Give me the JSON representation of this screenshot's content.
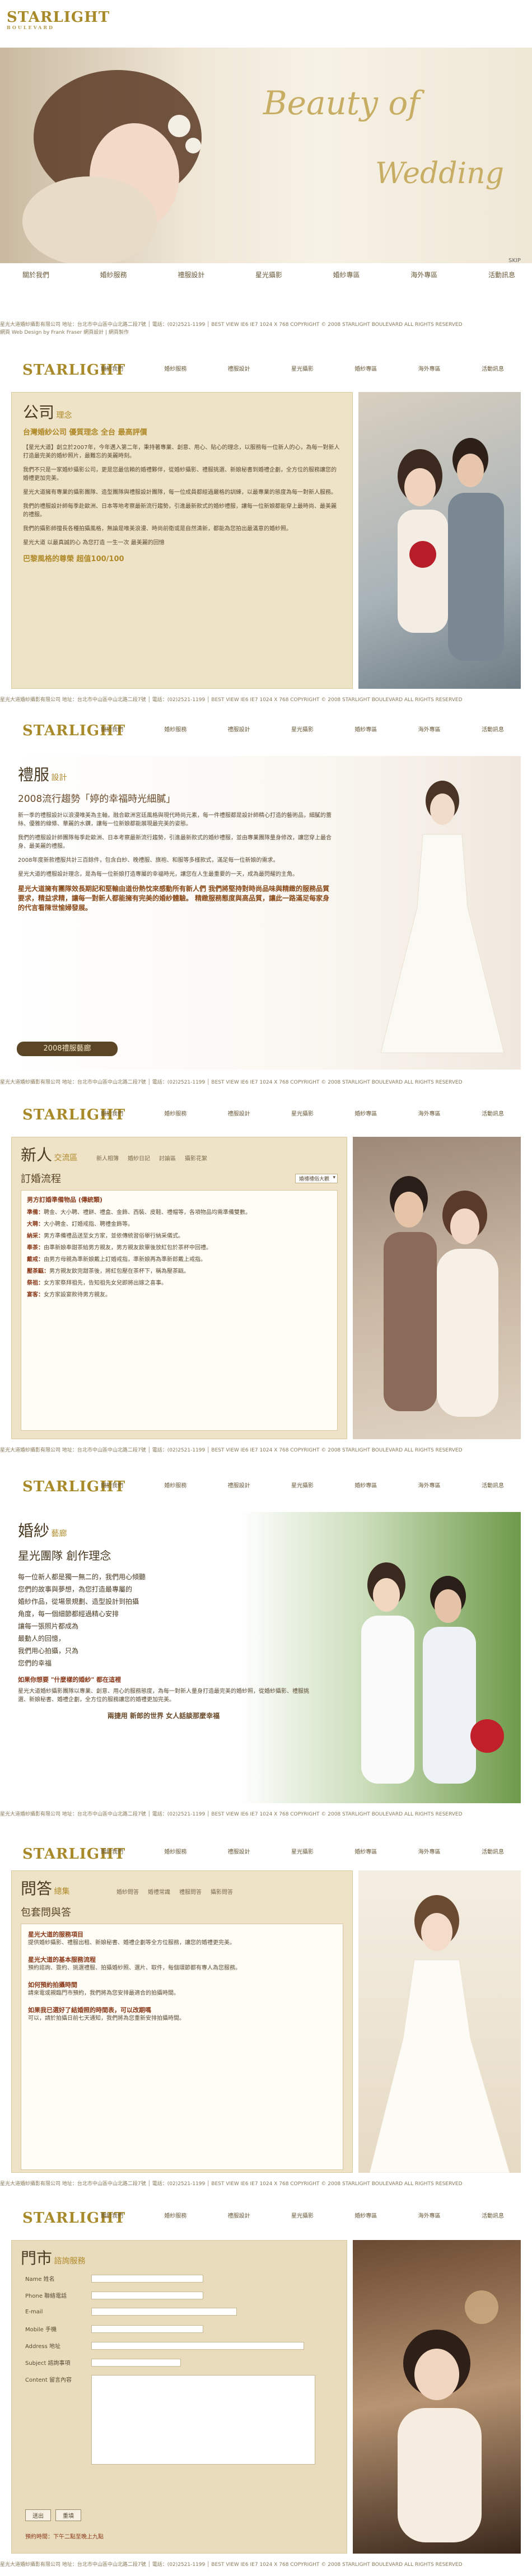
{
  "brand": {
    "logo": "STARLIGHT",
    "logo_sub": "BOULEVARD"
  },
  "hero": {
    "script_title": "Beauty of",
    "script_title2": "Wedding",
    "skip": "SKIP"
  },
  "nav": [
    "關於我們",
    "婚紗服務",
    "禮服設計",
    "星光攝影",
    "婚紗專區",
    "海外專區",
    "活動訊息"
  ],
  "footer": {
    "line1": "星光大道婚紗攝影有限公司 地址：台北市中山區中山北路二段7號 │ 電話：(02)2521-1199 │ BEST VIEW IE6 IE7 1024 X 768 COPYRIGHT © 2008 STARLIGHT BOULEVARD ALL RIGHTS RESERVED",
    "line2": "網頁 Web Design by Frank Fraser 網頁設計 | 網頁製作"
  },
  "company": {
    "title": "公司",
    "title_en": "理念",
    "headline": "台灣婚紗公司 優質理念 全台 最高評價",
    "paras": [
      "【星光大道】創立於2007年，今年邁入第二年，秉持著專業、創意、用心、貼心的理念，以服務每一位新人的心，為每一對新人打造最完美的婚紗照片，最難忘的美麗時刻。",
      "我們不只是一家婚紗攝影公司，更是您最信賴的婚禮夥伴，從婚紗攝影、禮服挑選、新娘秘書到婚禮企劃，全方位的服務讓您的婚禮更加完美。",
      "星光大道擁有專業的攝影團隊、造型團隊與禮服設計團隊，每一位成員都經過嚴格的訓練，以最專業的態度為每一對新人服務。",
      "我們的禮服設計師每季赴歐洲、日本等地考察最新流行趨勢，引進最新款式的婚紗禮服，讓每一位新娘都能穿上最時尚、最美麗的禮服。",
      "我們的攝影師擅長各種拍攝風格，無論是唯美浪漫、時尚前衛或是自然清新，都能為您拍出最滿意的婚紗照。",
      "星光大道 以最真誠的心 為您打造 一生一次 最美麗的回憶"
    ],
    "tagline": "巴黎風格的尊榮 超值100/100"
  },
  "gown": {
    "title": "禮服",
    "title_en": "設計",
    "headline": "2008流行趨勢「婷的幸福時光細膩」",
    "paras": [
      "新一季的禮服設計以浪漫唯美為主軸，融合歐洲宮廷風格與現代時尚元素，每一件禮服都是設計師精心打造的藝術品，細膩的蕾絲、優雅的線條、華麗的水鑽，讓每一位新娘都能展現最完美的姿態。",
      "我們的禮服設計師團隊每季赴歐洲、日本考察最新流行趨勢，引進最新款式的婚紗禮服，並由專業團隊量身修改，讓您穿上最合身、最美麗的禮服。",
      "2008年度新款禮服共計三百餘件，包含白紗、晚禮服、旗袍、和服等多樣款式，滿足每一位新娘的需求。",
      "星光大道的禮服設計理念，是為每一位新娘打造專屬的幸福時光，讓您在人生最重要的一天，成為最閃耀的主角。"
    ],
    "highlight": "星光大道擁有團隊效長期記和堅輸由道份熱忱來感動所有新人們 我們將堅持對時尚品味與精緻的服務品質要求，精益求精，讓每一對新人都能擁有完美的婚紗體驗。 精緻服務態度與高品質，讓此一路滿足每家身的代言看陳世愉婦發展。",
    "button": "2008禮服藝廊"
  },
  "couple": {
    "title": "新人",
    "title_en": "交流區",
    "tabs": [
      "新人相簿",
      "婚紗日記",
      "討論區",
      "攝影花絮"
    ],
    "panel_title": "訂婚流程",
    "select": "婚禮禮俗大觀",
    "sub": "男方訂婚準備物品 (傳統類)",
    "steps": [
      {
        "label": "準備：",
        "text": "聘金、大小聘、禮餅、禮盒、金飾、西裝、皮鞋、禮帽等，各項物品均需準備雙數。"
      },
      {
        "label": "大聘：",
        "text": "大小聘金、訂婚戒指、聘禮金飾等。"
      },
      {
        "label": "納采：",
        "text": "男方準備禮品送至女方家，並依傳統習俗舉行納采儀式。"
      },
      {
        "label": "奉茶：",
        "text": "由準新娘奉甜茶給男方親友，男方親友飲畢後放紅包於茶杯中回禮。"
      },
      {
        "label": "戴戒：",
        "text": "由男方母親為準新娘戴上訂婚戒指，準新娘再為準新郎戴上戒指。"
      },
      {
        "label": "壓茶甌：",
        "text": "男方親友飲完甜茶後，將紅包壓在茶杯下，稱為壓茶甌。"
      },
      {
        "label": "祭祖：",
        "text": "女方家祭拜祖先，告知祖先女兒即將出嫁之喜事。"
      },
      {
        "label": "宴客：",
        "text": "女方家設宴款待男方親友。"
      }
    ]
  },
  "wedding": {
    "title": "婚紗",
    "title_en": "藝廊",
    "headline": "星光團隊 創作理念",
    "lines": [
      "每一位新人都是獨一無二的，我們用心傾聽",
      "您們的故事與夢想，為您打造最專屬的",
      "婚紗作品，從場景規劃、造型設計到拍攝",
      "角度，每一個細節都經過精心安排",
      "讓每一張照片都成為",
      "最動人的回憶，",
      "我們用心拍攝，只為",
      "您們的幸福"
    ],
    "tagline": "如果你想要 \"什麼樣的婚紗\" 都在這裡",
    "para": "星光大道婚紗攝影團隊以專業、創意、用心的服務態度，為每一對新人量身打造最完美的婚紗照，從婚紗攝影、禮服挑選、新娘秘書、婚禮企劃，全方位的服務讓您的婚禮更加完美。",
    "footer_tag": "兩捷用 新郎的世界 女人話談那麼幸福"
  },
  "faq": {
    "title": "問答",
    "title_en": "總集",
    "tabs": [
      "婚紗問答",
      "婚禮常識",
      "禮服問答",
      "攝影問答"
    ],
    "panel_title": "包套問與答",
    "items": [
      {
        "q": "星光大道的服務項目",
        "a": "提供婚紗攝影、禮服出租、新娘秘書、婚禮企劃等全方位服務，讓您的婚禮更完美。"
      },
      {
        "q": "星光大道的基本服務流程",
        "a": "預約諮詢、簽約、挑選禮服、拍攝婚紗照、選片、取件，每個環節都有專人為您服務。"
      },
      {
        "q": "如何預約拍攝時間",
        "a": "請來電或親臨門市預約，我們將為您安排最適合的拍攝時間。"
      },
      {
        "q": "如果我已選好了結婚照的時間表，可以改期嗎",
        "a": "可以，請於拍攝日前七天通知，我們將為您重新安排拍攝時間。"
      }
    ]
  },
  "store": {
    "title": "門市",
    "title_en": "諮詢服務",
    "fields": [
      {
        "label": "Name 姓名",
        "extra": "",
        "extra2": ""
      },
      {
        "label": "Phone 聯絡電話",
        "extra": "",
        "extra2": ""
      },
      {
        "label": "E-mail",
        "extra": "",
        "extra2": ""
      },
      {
        "label": "Mobile 手機",
        "extra": "",
        "extra2": ""
      },
      {
        "label": "Address 地址",
        "extra": "",
        "extra2": ""
      },
      {
        "label": "Subject 諮詢事項",
        "extra": "",
        "extra2": ""
      },
      {
        "label": "Content 留言內容",
        "extra": "",
        "extra2": ""
      }
    ],
    "submit": "送出",
    "reset": "重填",
    "note": "預約時間：下午二點至晚上九點"
  }
}
